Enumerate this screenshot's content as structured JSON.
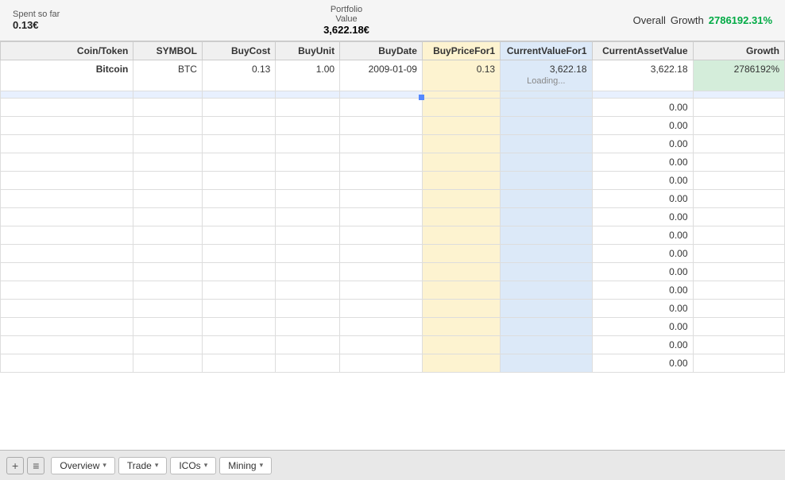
{
  "topBar": {
    "spentLabel": "Spent so far",
    "spentValue": "0.13€",
    "portfolioLabel1": "Portfolio",
    "portfolioLabel2": "Value",
    "portfolioValue": "3,622.18€",
    "overallLabel": "Overall",
    "growthLabel": "Growth",
    "growthValue": "2786192.31%"
  },
  "table": {
    "headers": [
      "Coin/Token",
      "SYMBOL",
      "BuyCost",
      "BuyUnit",
      "BuyDate",
      "BuyPriceFor1",
      "CurrentValueFor1",
      "CurrentAssetValue",
      "Growth"
    ],
    "bitcoin": {
      "coin": "Bitcoin",
      "symbol": "BTC",
      "buyCost": "0.13",
      "buyUnit": "1.00",
      "buyDate": "2009-01-09",
      "buyPriceFor1": "0.13",
      "currentValueFor1": "3,622.18",
      "currentAssetValue": "3,622.18",
      "growth": "2786192%",
      "loadingText": "Loading..."
    },
    "emptyValue": "0.00",
    "emptyRows": 15
  },
  "bottomBar": {
    "addIcon": "+",
    "menuIcon": "≡",
    "tabs": [
      {
        "label": "Overview",
        "arrow": "▾",
        "active": false
      },
      {
        "label": "Trade",
        "arrow": "▾",
        "active": false
      },
      {
        "label": "ICOs",
        "arrow": "▾",
        "active": false
      },
      {
        "label": "Mining",
        "arrow": "▾",
        "active": false
      }
    ]
  }
}
